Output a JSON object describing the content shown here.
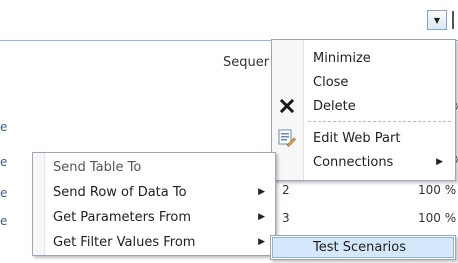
{
  "background": {
    "column_header": "Sequer",
    "rows": [
      {
        "left_fragment": "e",
        "percent": "%"
      },
      {
        "left_fragment": "e",
        "percent": "%"
      },
      {
        "left_fragment": "e",
        "number": "2",
        "percent": "100 %"
      },
      {
        "left_fragment": "e",
        "number": "3",
        "percent": "100 %"
      }
    ],
    "edge_marker": "|"
  },
  "web_part_menu": {
    "dropdown_glyph": "▼",
    "items": [
      {
        "label": "Minimize",
        "icon": ""
      },
      {
        "label": "Close",
        "icon": ""
      },
      {
        "label": "Delete",
        "icon": "delete-x-icon"
      },
      {
        "label": "Edit Web Part",
        "icon": "edit-web-part-icon"
      },
      {
        "label": "Connections",
        "icon": "",
        "submenu_arrow": "▶"
      }
    ]
  },
  "connections_menu": {
    "items": [
      {
        "label": "Send Table To",
        "disabled": true
      },
      {
        "label": "Send Row of Data To",
        "submenu_arrow": "▶"
      },
      {
        "label": "Get Parameters From",
        "submenu_arrow": "▶"
      },
      {
        "label": "Get Filter Values From",
        "submenu_arrow": "▶"
      }
    ]
  },
  "filter_submenu": {
    "items": [
      {
        "label": "Test Scenarios"
      }
    ]
  }
}
